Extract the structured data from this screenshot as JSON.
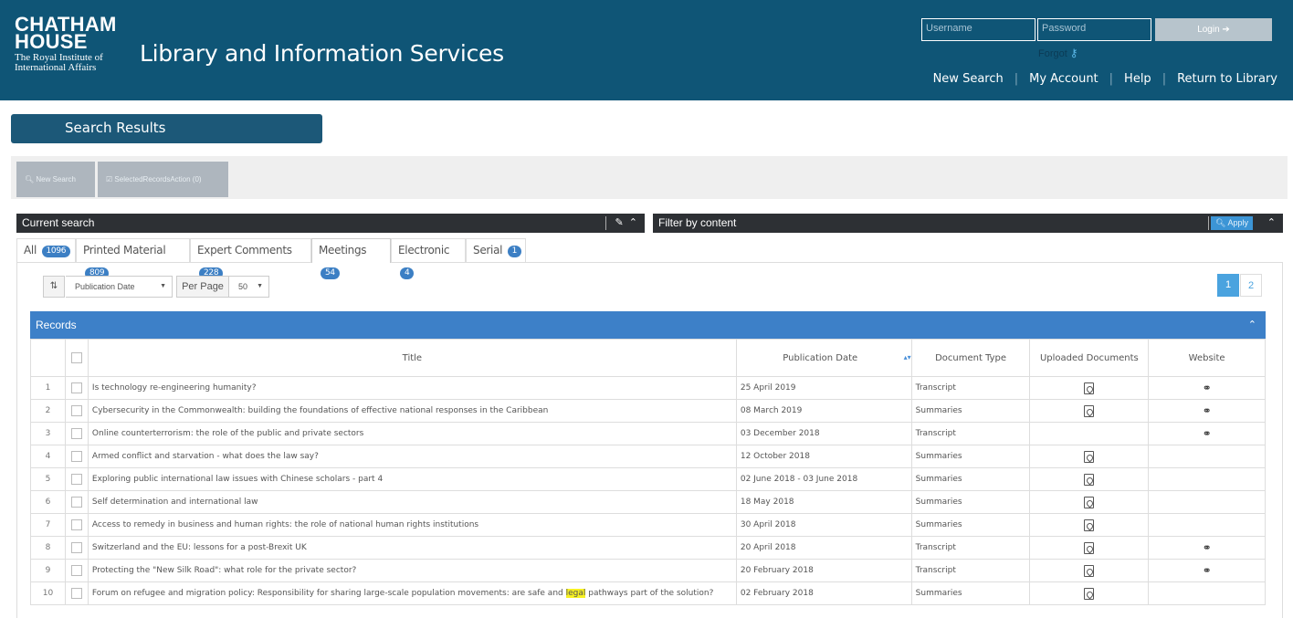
{
  "header": {
    "logo_line1": "CHATHAM",
    "logo_line2": "HOUSE",
    "logo_line3": "The Royal Institute of",
    "logo_line4": "International Affairs",
    "title": "Library and Information Services",
    "username_placeholder": "Username",
    "password_placeholder": "Password",
    "login_label": "Login ➔",
    "forgot_label": "Forgot",
    "nav": [
      "New Search",
      "My Account",
      "Help",
      "Return to Library"
    ],
    "bg_color": "#0f5576"
  },
  "results_title": "Search Results",
  "toolbar": {
    "new_search": "New Search",
    "selected_action": "SelectedRecordsAction (0)"
  },
  "current_search_title": "Current search",
  "filter_title": "Filter by content",
  "apply_label": "Apply",
  "tabs": [
    {
      "label": "All",
      "count": "1096"
    },
    {
      "label": "Printed Material",
      "count": "809"
    },
    {
      "label": "Expert Comments",
      "count": "228"
    },
    {
      "label": "Meetings",
      "count": "54",
      "active": true
    },
    {
      "label": "Electronic",
      "count": "4"
    },
    {
      "label": "Serial",
      "count": "1"
    }
  ],
  "sort": {
    "selected": "Publication Date",
    "per_page_label": "Per Page",
    "per_page": "50"
  },
  "pagination": [
    "1",
    "2"
  ],
  "records": {
    "title": "Records",
    "columns": [
      "Title",
      "Publication Date",
      "Document Type",
      "Uploaded Documents",
      "Website"
    ],
    "rows": [
      {
        "n": "1",
        "title": "Is technology re-engineering humanity?",
        "date": "25 April 2019",
        "type": "Transcript",
        "doc": true,
        "web": true
      },
      {
        "n": "2",
        "title": "Cybersecurity in the Commonwealth: building the foundations of effective national responses in the Caribbean",
        "date": "08 March 2019",
        "type": "Summaries",
        "doc": true,
        "web": true
      },
      {
        "n": "3",
        "title": "Online counterterrorism: the role of the public and private sectors",
        "date": "03 December 2018",
        "type": "Transcript",
        "doc": false,
        "web": true
      },
      {
        "n": "4",
        "title": "Armed conflict and starvation - what does the law say?",
        "date": "12 October 2018",
        "type": "Summaries",
        "doc": true,
        "web": false
      },
      {
        "n": "5",
        "title": "Exploring public international law issues with Chinese scholars - part 4",
        "date": "02 June 2018 - 03 June 2018",
        "type": "Summaries",
        "doc": true,
        "web": false
      },
      {
        "n": "6",
        "title": "Self determination and international law",
        "date": "18 May 2018",
        "type": "Summaries",
        "doc": true,
        "web": false
      },
      {
        "n": "7",
        "title": "Access to remedy in business and human rights: the role of national human rights institutions",
        "date": "30 April 2018",
        "type": "Summaries",
        "doc": true,
        "web": false
      },
      {
        "n": "8",
        "title": "Switzerland and the EU: lessons for a post-Brexit UK",
        "date": "20 April 2018",
        "type": "Transcript",
        "doc": true,
        "web": true
      },
      {
        "n": "9",
        "title": "Protecting the \"New Silk Road\": what role for the private sector?",
        "date": "20 February 2018",
        "type": "Transcript",
        "doc": true,
        "web": true
      },
      {
        "n": "10",
        "title_before": "Forum on refugee and migration policy: Responsibility for sharing large-scale population movements: are safe and ",
        "title_highlight": "legal",
        "title_after": " pathways part of the solution?",
        "date": "02 February 2018",
        "type": "Summaries",
        "doc": true,
        "web": false
      }
    ]
  }
}
